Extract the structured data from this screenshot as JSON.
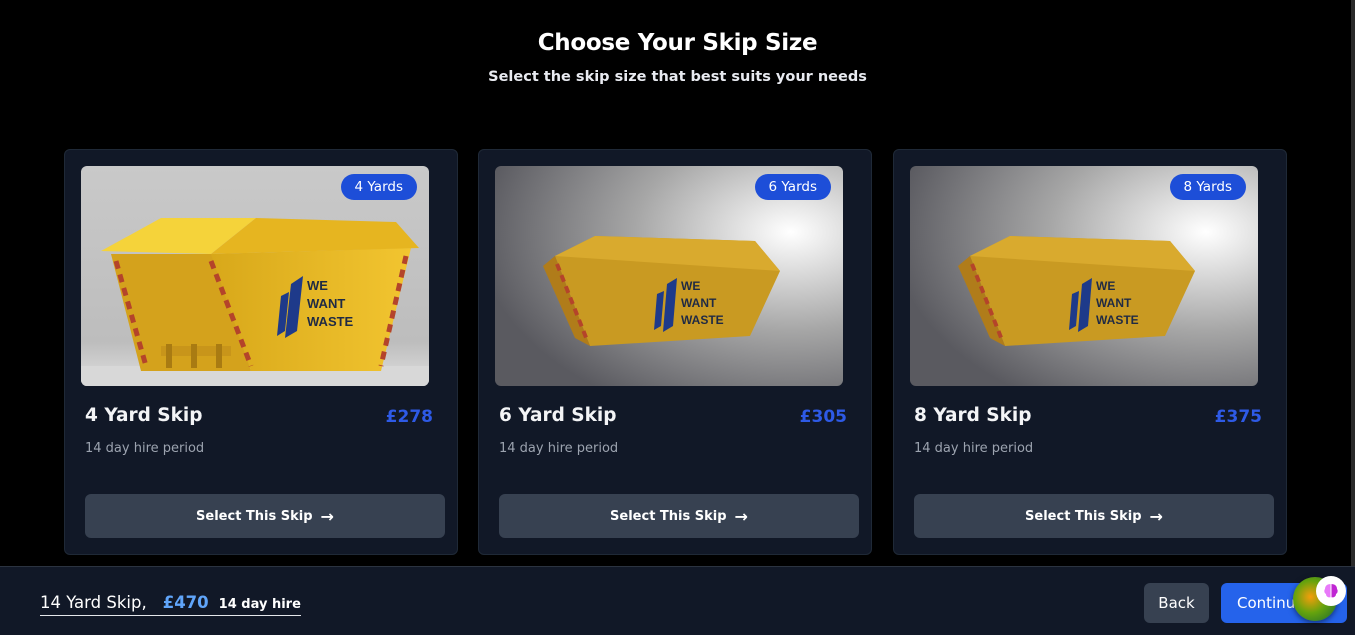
{
  "header": {
    "title": "Choose Your Skip Size",
    "subtitle": "Select the skip size that best suits your needs"
  },
  "cards": [
    {
      "badge": "4 Yards",
      "name": "4 Yard Skip",
      "price": "£278",
      "period": "14 day hire period",
      "button": "Select This Skip",
      "brand": [
        "WE",
        "WANT",
        "WASTE"
      ]
    },
    {
      "badge": "6 Yards",
      "name": "6 Yard Skip",
      "price": "£305",
      "period": "14 day hire period",
      "button": "Select This Skip",
      "brand": [
        "WE",
        "WANT",
        "WASTE"
      ]
    },
    {
      "badge": "8 Yards",
      "name": "8 Yard Skip",
      "price": "£375",
      "period": "14 day hire period",
      "button": "Select This Skip",
      "brand": [
        "WE",
        "WANT",
        "WASTE"
      ]
    }
  ],
  "footer": {
    "selected_name": "14 Yard Skip",
    "separator": ",",
    "selected_price": "£470",
    "selected_hire": "14 day hire",
    "back_label": "Back",
    "continue_label": "Continue"
  },
  "icons": {
    "select_arrow": "arrow-right-icon",
    "assistant": "assistant-avatar-icon",
    "brain": "brain-icon"
  },
  "colors": {
    "accent": "#2563eb",
    "price": "#2e5ae6",
    "card_bg": "#111827",
    "button_bg": "#374151",
    "skip_yellow": "#e8b923"
  }
}
